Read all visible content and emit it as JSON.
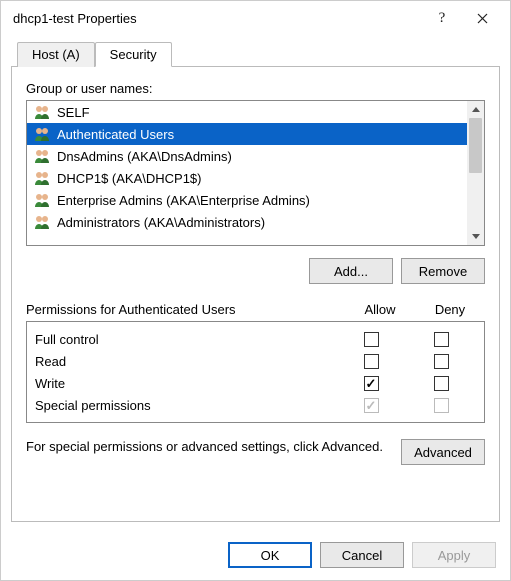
{
  "window": {
    "title": "dhcp1-test Properties"
  },
  "tabs": {
    "host": "Host (A)",
    "security": "Security"
  },
  "group_label": "Group or user names:",
  "groups": [
    {
      "name": "SELF"
    },
    {
      "name": "Authenticated Users"
    },
    {
      "name": "DnsAdmins (AKA\\DnsAdmins)"
    },
    {
      "name": "DHCP1$ (AKA\\DHCP1$)"
    },
    {
      "name": "Enterprise Admins (AKA\\Enterprise Admins)"
    },
    {
      "name": "Administrators (AKA\\Administrators)"
    }
  ],
  "buttons": {
    "add": "Add...",
    "remove": "Remove",
    "advanced": "Advanced",
    "ok": "OK",
    "cancel": "Cancel",
    "apply": "Apply"
  },
  "perm_header": {
    "title": "Permissions for Authenticated Users",
    "allow": "Allow",
    "deny": "Deny"
  },
  "permissions": [
    {
      "name": "Full control",
      "allow": false,
      "deny": false,
      "disabled": false
    },
    {
      "name": "Read",
      "allow": false,
      "deny": false,
      "disabled": false
    },
    {
      "name": "Write",
      "allow": true,
      "deny": false,
      "disabled": false
    },
    {
      "name": "Special permissions",
      "allow": true,
      "deny": false,
      "disabled": true
    }
  ],
  "advanced_text": "For special permissions or advanced settings, click Advanced."
}
